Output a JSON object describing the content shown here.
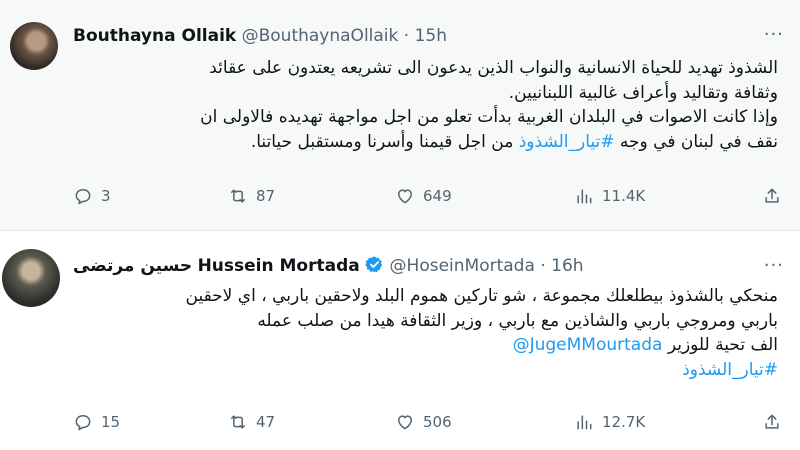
{
  "tweets": [
    {
      "display_name": "Bouthayna Ollaik",
      "handle": "@BouthaynaOllaik",
      "time": "15h",
      "text_lines": [
        "الشذوذ تهديد للحياة الانسانية والنواب الذين يدعون الى تشريعه يعتدون على عقائد",
        "وثقافة وتقاليد وأعراف غالبية اللبنانيين.",
        "وإذا كانت الاصوات في البلدان الغربية بدأت تعلو من اجل مواجهة تهديده فالاولى ان"
      ],
      "last_line_prefix": "نقف في لبنان في وجه",
      "hashtag": "#تيار_الشذوذ",
      "last_line_suffix": "من اجل قيمنا وأسرنا ومستقبل حياتنا.",
      "replies": "3",
      "retweets": "87",
      "likes": "649",
      "views": "11.4K"
    },
    {
      "display_name_ar": "حسين مرتضى",
      "display_name": "Hussein Mortada",
      "handle": "@HoseinMortada",
      "time": "16h",
      "text_lines": [
        "منحكي بالشذوذ بيطلعلك مجموعة ، شو تاركين هموم البلد ولاحقين باربي ، اي لاحقين",
        "باربي ومروجي باربي والشاذين مع باربي ، وزير الثقافة هيدا من صلب عمله"
      ],
      "line3_prefix": "الف تحية للوزير",
      "mention": "@JugeMMourtada",
      "hashtag": "#تيار_الشذوذ",
      "replies": "15",
      "retweets": "47",
      "likes": "506",
      "views": "12.7K"
    }
  ],
  "more_label": "···",
  "colors": {
    "accent": "#1d9bf0",
    "verified": "#1d9bf0",
    "muted": "#536471"
  },
  "icons": [
    "reply-icon",
    "retweet-icon",
    "like-icon",
    "views-icon",
    "share-icon",
    "verified-badge-icon",
    "more-icon"
  ]
}
